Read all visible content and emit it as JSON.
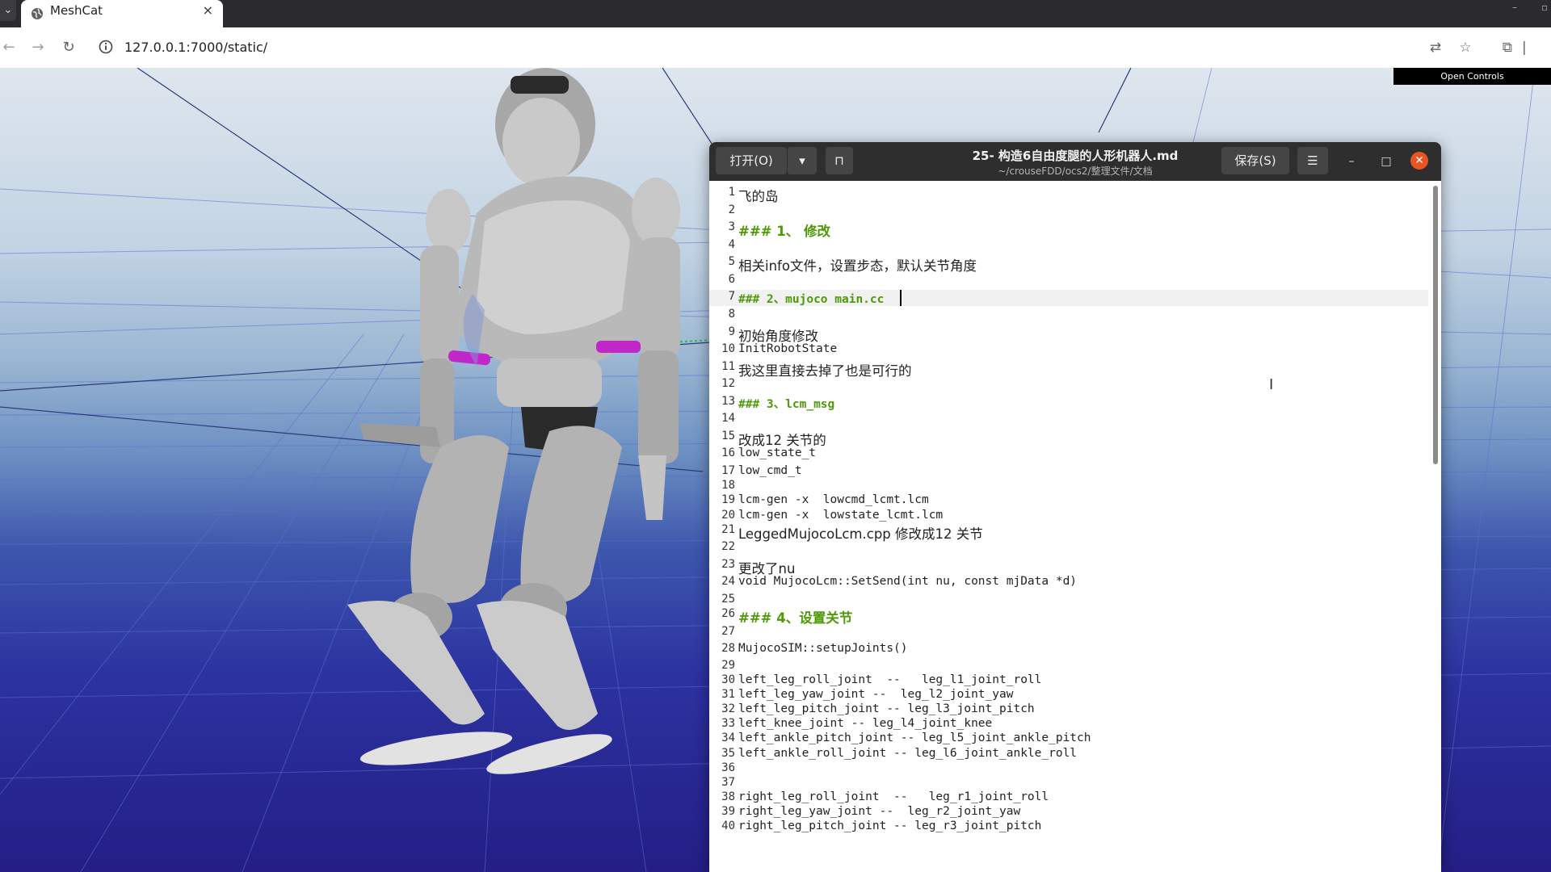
{
  "browser": {
    "tab_title": "MeshCat",
    "tab_close": "×",
    "url": "127.0.0.1:7000/static/",
    "menu_glyph": "⌄",
    "icons": [
      "back-icon",
      "forward-icon",
      "reload-icon",
      "site-info-icon",
      "translate-icon",
      "bookmark-star-icon",
      "extensions-icon"
    ]
  },
  "viewer": {
    "open_controls": "Open Controls"
  },
  "editor": {
    "open_label": "打开(O)",
    "title": "25- 构造6自由度腿的人形机器人.md",
    "path": "~/crouseFDD/ocs2/整理文件/文档",
    "save_label": "保存(S)",
    "lines": [
      {
        "n": "1",
        "t": "飞的岛"
      },
      {
        "n": "2",
        "t": ""
      },
      {
        "n": "3",
        "t": "### 1、 修改"
      },
      {
        "n": "4",
        "t": ""
      },
      {
        "n": "5",
        "t": "相关info文件，设置步态，默认关节角度"
      },
      {
        "n": "6",
        "t": ""
      },
      {
        "n": "7",
        "t": "### 2、mujoco main.cc"
      },
      {
        "n": "8",
        "t": ""
      },
      {
        "n": "9",
        "t": "初始角度修改"
      },
      {
        "n": "10",
        "t": "InitRobotState"
      },
      {
        "n": "11",
        "t": "我这里直接去掉了也是可行的"
      },
      {
        "n": "12",
        "t": ""
      },
      {
        "n": "13",
        "t": "### 3、lcm_msg"
      },
      {
        "n": "14",
        "t": ""
      },
      {
        "n": "15",
        "t": "改成12 关节的"
      },
      {
        "n": "16",
        "t": "low_state_t"
      },
      {
        "n": "17",
        "t": "low_cmd_t"
      },
      {
        "n": "18",
        "t": ""
      },
      {
        "n": "19",
        "t": "lcm-gen -x  lowcmd_lcmt.lcm"
      },
      {
        "n": "20",
        "t": "lcm-gen -x  lowstate_lcmt.lcm"
      },
      {
        "n": "21",
        "t": "LeggedMujocoLcm.cpp 修改成12 关节"
      },
      {
        "n": "22",
        "t": ""
      },
      {
        "n": "23",
        "t": "更改了nu"
      },
      {
        "n": "24",
        "t": "void MujocoLcm::SetSend(int nu, const mjData *d)"
      },
      {
        "n": "25",
        "t": ""
      },
      {
        "n": "26",
        "t": "### 4、设置关节"
      },
      {
        "n": "27",
        "t": ""
      },
      {
        "n": "28",
        "t": "MujocoSIM::setupJoints()"
      },
      {
        "n": "29",
        "t": ""
      },
      {
        "n": "30",
        "t": "left_leg_roll_joint  --   leg_l1_joint_roll"
      },
      {
        "n": "31",
        "t": "left_leg_yaw_joint --  leg_l2_joint_yaw"
      },
      {
        "n": "32",
        "t": "left_leg_pitch_joint -- leg_l3_joint_pitch"
      },
      {
        "n": "33",
        "t": "left_knee_joint -- leg_l4_joint_knee"
      },
      {
        "n": "34",
        "t": "left_ankle_pitch_joint -- leg_l5_joint_ankle_pitch"
      },
      {
        "n": "35",
        "t": "left_ankle_roll_joint -- leg_l6_joint_ankle_roll"
      },
      {
        "n": "36",
        "t": ""
      },
      {
        "n": "37",
        "t": ""
      },
      {
        "n": "38",
        "t": "right_leg_roll_joint  --   leg_r1_joint_roll"
      },
      {
        "n": "39",
        "t": "right_leg_yaw_joint --  leg_r2_joint_yaw"
      },
      {
        "n": "40",
        "t": "right_leg_pitch_joint -- leg_r3_joint_pitch"
      }
    ]
  },
  "colors": {
    "heading": "#4e9a06",
    "close_button": "#e95420",
    "header_bar": "#2e2e2e",
    "accent_magenta": "#c026c8"
  }
}
